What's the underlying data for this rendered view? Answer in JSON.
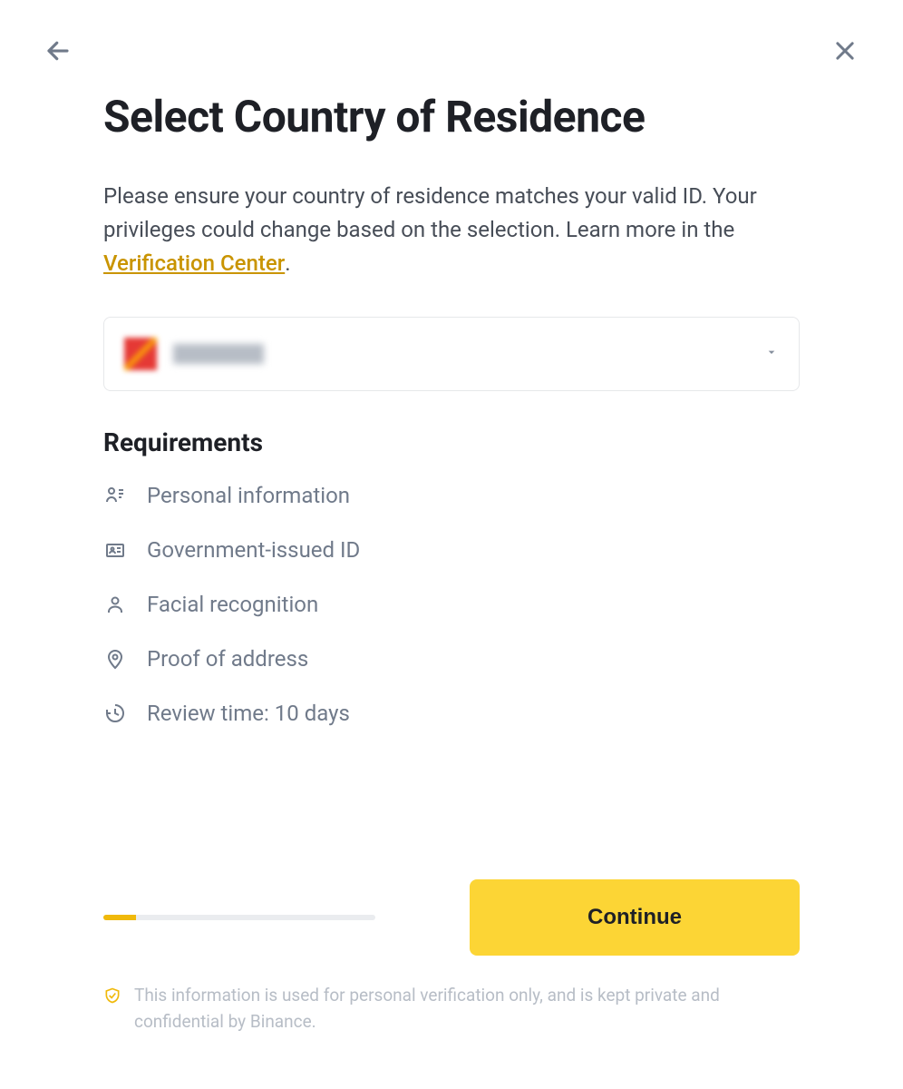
{
  "header": {
    "title": "Select Country of Residence",
    "description_prefix": "Please ensure your country of residence matches your valid ID. Your privileges could change based on the selection. Learn more in the ",
    "link_text": "Verification Center",
    "description_suffix": "."
  },
  "country_select": {
    "selected_label": ""
  },
  "requirements": {
    "heading": "Requirements",
    "items": [
      {
        "icon": "person-lines-icon",
        "label": "Personal information"
      },
      {
        "icon": "id-card-icon",
        "label": "Government-issued ID"
      },
      {
        "icon": "face-icon",
        "label": "Facial recognition"
      },
      {
        "icon": "pin-icon",
        "label": "Proof of address"
      },
      {
        "icon": "clock-icon",
        "label": "Review time: 10 days"
      }
    ]
  },
  "footer": {
    "continue_label": "Continue",
    "progress_percent": 12,
    "disclaimer": "This information is used for personal verification only, and is kept private and confidential by Binance."
  }
}
